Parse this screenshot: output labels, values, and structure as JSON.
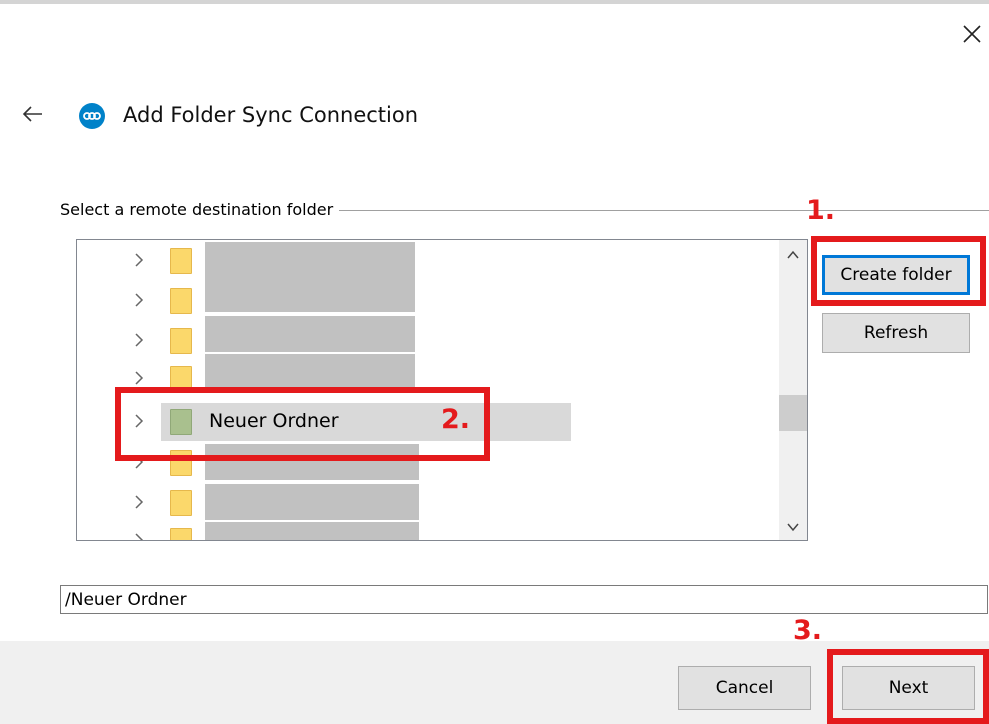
{
  "dialog": {
    "title": "Add Folder Sync Connection",
    "close_glyph": "×",
    "back_icon": "back-arrow-icon",
    "logo_icon": "nextcloud-logo-icon"
  },
  "folder_picker": {
    "group_label": "Select a remote destination folder",
    "selected_item": {
      "label": "Neuer Ordner"
    },
    "buttons": {
      "create_folder": "Create folder",
      "refresh": "Refresh"
    }
  },
  "path_field": {
    "value": "/Neuer Ordner"
  },
  "footer": {
    "cancel": "Cancel",
    "next": "Next"
  },
  "annotations": {
    "step1": "1.",
    "step2": "2.",
    "step3": "3.",
    "color": "#e41a1c"
  }
}
